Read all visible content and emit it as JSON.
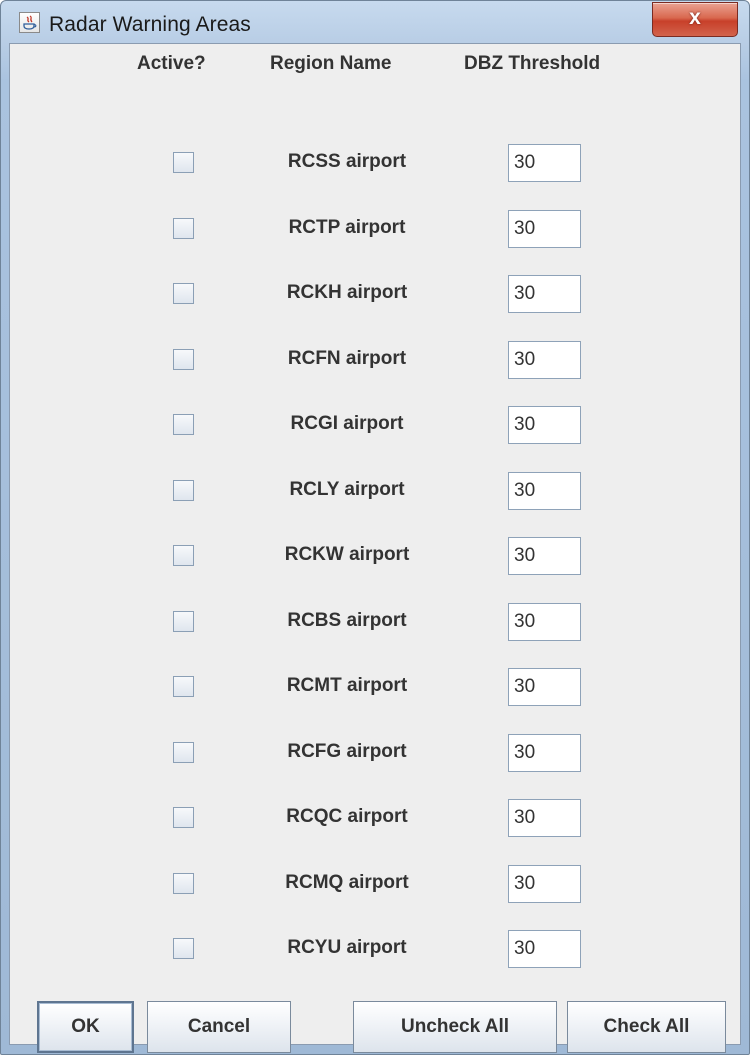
{
  "window": {
    "title": "Radar Warning Areas",
    "close_glyph": "x"
  },
  "headers": {
    "active": "Active?",
    "region": "Region Name",
    "threshold": "DBZ Threshold"
  },
  "rows": [
    {
      "active": false,
      "name": "RCSS airport",
      "threshold": "30"
    },
    {
      "active": false,
      "name": "RCTP airport",
      "threshold": "30"
    },
    {
      "active": false,
      "name": "RCKH airport",
      "threshold": "30"
    },
    {
      "active": false,
      "name": "RCFN airport",
      "threshold": "30"
    },
    {
      "active": false,
      "name": "RCGI airport",
      "threshold": "30"
    },
    {
      "active": false,
      "name": "RCLY airport",
      "threshold": "30"
    },
    {
      "active": false,
      "name": "RCKW airport",
      "threshold": "30"
    },
    {
      "active": false,
      "name": "RCBS airport",
      "threshold": "30"
    },
    {
      "active": false,
      "name": "RCMT airport",
      "threshold": "30"
    },
    {
      "active": false,
      "name": "RCFG airport",
      "threshold": "30"
    },
    {
      "active": false,
      "name": "RCQC airport",
      "threshold": "30"
    },
    {
      "active": false,
      "name": "RCMQ airport",
      "threshold": "30"
    },
    {
      "active": false,
      "name": "RCYU airport",
      "threshold": "30"
    }
  ],
  "buttons": {
    "ok": "OK",
    "cancel": "Cancel",
    "uncheck_all": "Uncheck All",
    "check_all": "Check All"
  },
  "icons": {
    "app": "java-icon",
    "close": "close-icon"
  },
  "colors": {
    "close_button": "#c8402a",
    "dialog_background": "#eeeeee",
    "title_gradient": "#b9cee6"
  }
}
